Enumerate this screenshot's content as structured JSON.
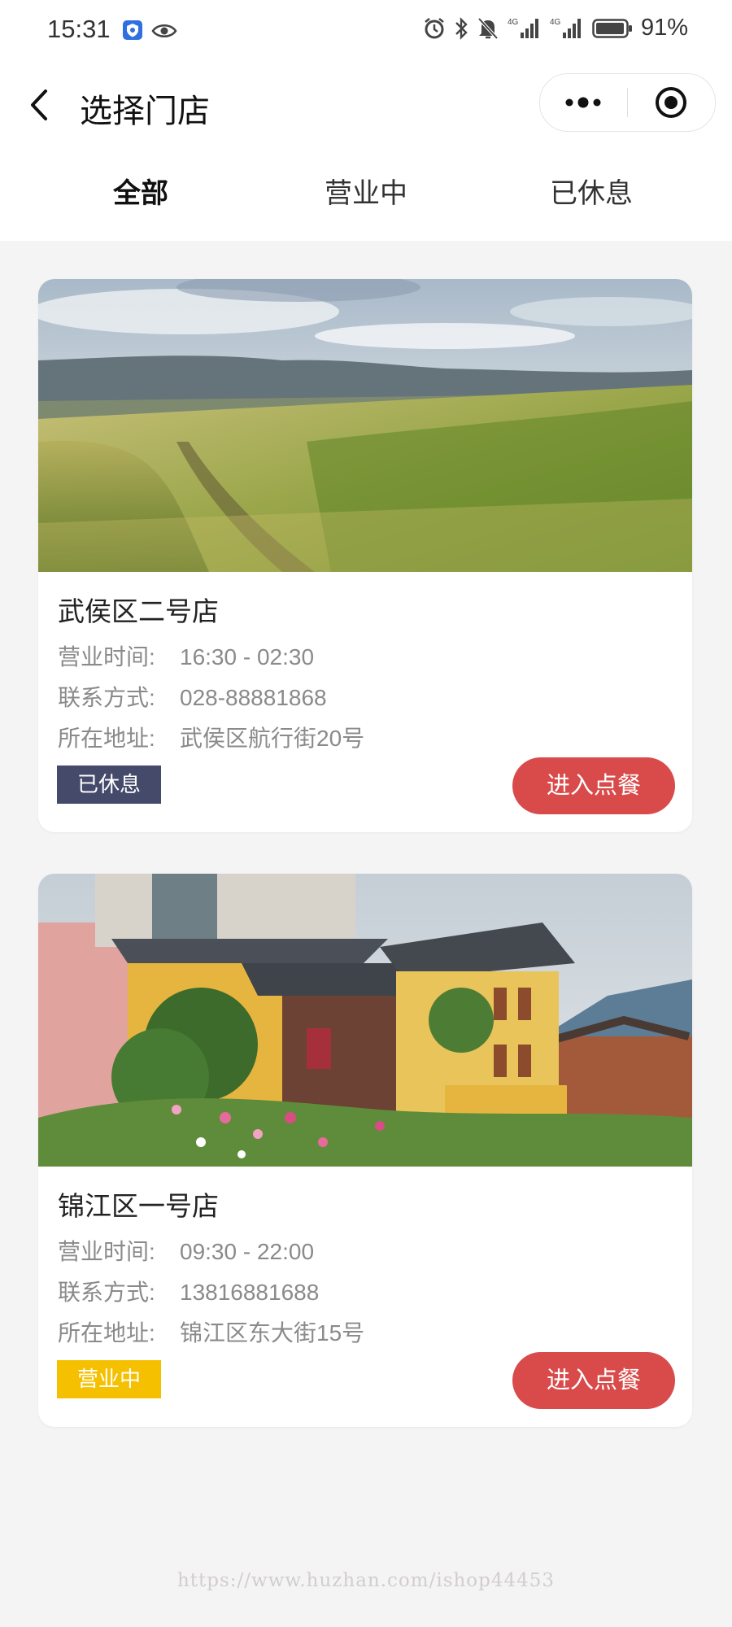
{
  "status_bar": {
    "time": "15:31",
    "battery": "91%",
    "icons": [
      "shield-icon",
      "eye-icon",
      "alarm-icon",
      "bluetooth-icon",
      "mute-icon",
      "signal-4g-icon",
      "signal-4g-icon",
      "battery-icon"
    ]
  },
  "header": {
    "title": "选择门店",
    "back_icon": "chevron-left-icon",
    "capsule": {
      "more_icon": "more-dots-icon",
      "close_icon": "target-icon"
    }
  },
  "tabs": [
    {
      "label": "全部",
      "active": true
    },
    {
      "label": "营业中",
      "active": false
    },
    {
      "label": "已休息",
      "active": false
    }
  ],
  "stores": [
    {
      "name": "武侯区二号店",
      "photo": "wheat-field-photo",
      "hours_label": "营业时间:",
      "hours": "16:30 - 02:30",
      "phone_label": "联系方式:",
      "phone": "028-88881868",
      "address_label": "所在地址:",
      "address": "武侯区航行街20号",
      "status": "已休息",
      "status_color": "#454a6b",
      "button": "进入点餐"
    },
    {
      "name": "锦江区一号店",
      "photo": "village-house-photo",
      "hours_label": "营业时间:",
      "hours": "09:30 - 22:00",
      "phone_label": "联系方式:",
      "phone": "13816881688",
      "address_label": "所在地址:",
      "address": "锦江区东大街15号",
      "status": "营业中",
      "status_color": "#f5c000",
      "button": "进入点餐"
    }
  ],
  "colors": {
    "accent_button": "#d94b4b",
    "page_background": "#f4f4f5"
  },
  "watermark": "https://www.huzhan.com/ishop44453"
}
